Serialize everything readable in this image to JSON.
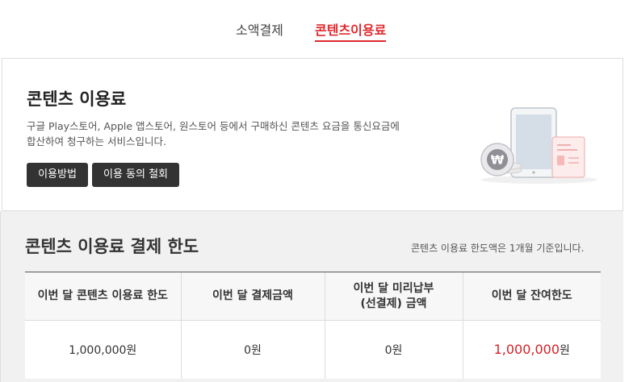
{
  "tabs": [
    {
      "label": "소액결제",
      "active": false
    },
    {
      "label": "콘텐츠이용료",
      "active": true
    }
  ],
  "hero": {
    "title": "콘텐츠 이용료",
    "description_line1": "구글 Play스토어, Apple 앱스토어, 원스토어 등에서 구매하신 콘텐츠 요금을 통신요금에",
    "description_line2": "합산하여 청구하는 서비스입니다.",
    "button_howto": "이용방법",
    "button_withdraw": "이용 동의 철회",
    "illustration_icons": [
      "tablet-icon",
      "document-icon",
      "won-coin-icon"
    ]
  },
  "limit": {
    "title": "콘텐츠 이용료 결제 한도",
    "note": "콘텐츠 이용료 한도액은 1개월 기준입니다.",
    "columns": [
      "이번 달 콘텐츠 이용료 한도",
      "이번 달 결제금액",
      "이번 달 미리납부",
      "(선결제) 금액",
      "이번 달 잔여한도"
    ],
    "row": {
      "monthly_limit": "1,000,000원",
      "paid_amount": "0원",
      "prepaid_amount": "0원",
      "remaining_value": "1,000,000",
      "remaining_unit": "원"
    }
  },
  "colors": {
    "accent": "#e0282e",
    "remaining": "#d91f24",
    "button": "#333333"
  }
}
